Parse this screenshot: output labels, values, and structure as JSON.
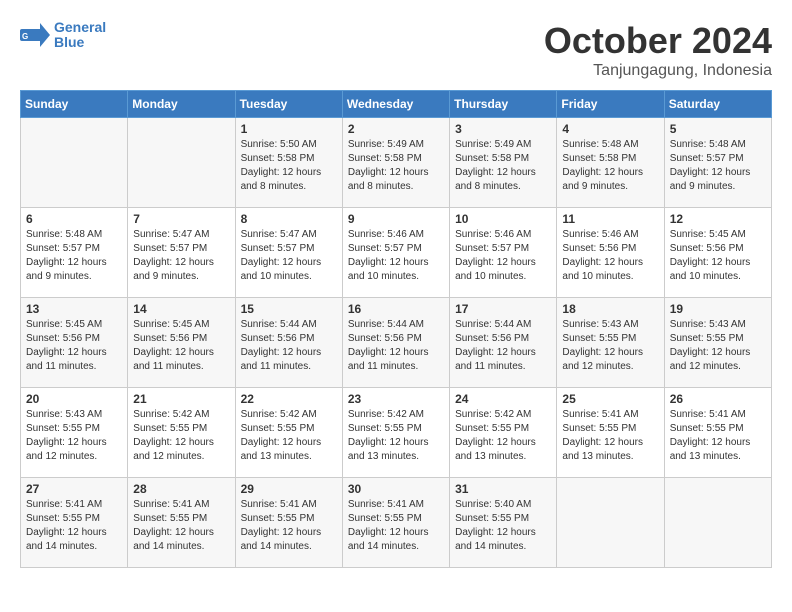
{
  "header": {
    "logo_line1": "General",
    "logo_line2": "Blue",
    "month": "October 2024",
    "location": "Tanjungagung, Indonesia"
  },
  "weekdays": [
    "Sunday",
    "Monday",
    "Tuesday",
    "Wednesday",
    "Thursday",
    "Friday",
    "Saturday"
  ],
  "weeks": [
    [
      {
        "day": "",
        "text": ""
      },
      {
        "day": "",
        "text": ""
      },
      {
        "day": "1",
        "text": "Sunrise: 5:50 AM\nSunset: 5:58 PM\nDaylight: 12 hours\nand 8 minutes."
      },
      {
        "day": "2",
        "text": "Sunrise: 5:49 AM\nSunset: 5:58 PM\nDaylight: 12 hours\nand 8 minutes."
      },
      {
        "day": "3",
        "text": "Sunrise: 5:49 AM\nSunset: 5:58 PM\nDaylight: 12 hours\nand 8 minutes."
      },
      {
        "day": "4",
        "text": "Sunrise: 5:48 AM\nSunset: 5:58 PM\nDaylight: 12 hours\nand 9 minutes."
      },
      {
        "day": "5",
        "text": "Sunrise: 5:48 AM\nSunset: 5:57 PM\nDaylight: 12 hours\nand 9 minutes."
      }
    ],
    [
      {
        "day": "6",
        "text": "Sunrise: 5:48 AM\nSunset: 5:57 PM\nDaylight: 12 hours\nand 9 minutes."
      },
      {
        "day": "7",
        "text": "Sunrise: 5:47 AM\nSunset: 5:57 PM\nDaylight: 12 hours\nand 9 minutes."
      },
      {
        "day": "8",
        "text": "Sunrise: 5:47 AM\nSunset: 5:57 PM\nDaylight: 12 hours\nand 10 minutes."
      },
      {
        "day": "9",
        "text": "Sunrise: 5:46 AM\nSunset: 5:57 PM\nDaylight: 12 hours\nand 10 minutes."
      },
      {
        "day": "10",
        "text": "Sunrise: 5:46 AM\nSunset: 5:57 PM\nDaylight: 12 hours\nand 10 minutes."
      },
      {
        "day": "11",
        "text": "Sunrise: 5:46 AM\nSunset: 5:56 PM\nDaylight: 12 hours\nand 10 minutes."
      },
      {
        "day": "12",
        "text": "Sunrise: 5:45 AM\nSunset: 5:56 PM\nDaylight: 12 hours\nand 10 minutes."
      }
    ],
    [
      {
        "day": "13",
        "text": "Sunrise: 5:45 AM\nSunset: 5:56 PM\nDaylight: 12 hours\nand 11 minutes."
      },
      {
        "day": "14",
        "text": "Sunrise: 5:45 AM\nSunset: 5:56 PM\nDaylight: 12 hours\nand 11 minutes."
      },
      {
        "day": "15",
        "text": "Sunrise: 5:44 AM\nSunset: 5:56 PM\nDaylight: 12 hours\nand 11 minutes."
      },
      {
        "day": "16",
        "text": "Sunrise: 5:44 AM\nSunset: 5:56 PM\nDaylight: 12 hours\nand 11 minutes."
      },
      {
        "day": "17",
        "text": "Sunrise: 5:44 AM\nSunset: 5:56 PM\nDaylight: 12 hours\nand 11 minutes."
      },
      {
        "day": "18",
        "text": "Sunrise: 5:43 AM\nSunset: 5:55 PM\nDaylight: 12 hours\nand 12 minutes."
      },
      {
        "day": "19",
        "text": "Sunrise: 5:43 AM\nSunset: 5:55 PM\nDaylight: 12 hours\nand 12 minutes."
      }
    ],
    [
      {
        "day": "20",
        "text": "Sunrise: 5:43 AM\nSunset: 5:55 PM\nDaylight: 12 hours\nand 12 minutes."
      },
      {
        "day": "21",
        "text": "Sunrise: 5:42 AM\nSunset: 5:55 PM\nDaylight: 12 hours\nand 12 minutes."
      },
      {
        "day": "22",
        "text": "Sunrise: 5:42 AM\nSunset: 5:55 PM\nDaylight: 12 hours\nand 13 minutes."
      },
      {
        "day": "23",
        "text": "Sunrise: 5:42 AM\nSunset: 5:55 PM\nDaylight: 12 hours\nand 13 minutes."
      },
      {
        "day": "24",
        "text": "Sunrise: 5:42 AM\nSunset: 5:55 PM\nDaylight: 12 hours\nand 13 minutes."
      },
      {
        "day": "25",
        "text": "Sunrise: 5:41 AM\nSunset: 5:55 PM\nDaylight: 12 hours\nand 13 minutes."
      },
      {
        "day": "26",
        "text": "Sunrise: 5:41 AM\nSunset: 5:55 PM\nDaylight: 12 hours\nand 13 minutes."
      }
    ],
    [
      {
        "day": "27",
        "text": "Sunrise: 5:41 AM\nSunset: 5:55 PM\nDaylight: 12 hours\nand 14 minutes."
      },
      {
        "day": "28",
        "text": "Sunrise: 5:41 AM\nSunset: 5:55 PM\nDaylight: 12 hours\nand 14 minutes."
      },
      {
        "day": "29",
        "text": "Sunrise: 5:41 AM\nSunset: 5:55 PM\nDaylight: 12 hours\nand 14 minutes."
      },
      {
        "day": "30",
        "text": "Sunrise: 5:41 AM\nSunset: 5:55 PM\nDaylight: 12 hours\nand 14 minutes."
      },
      {
        "day": "31",
        "text": "Sunrise: 5:40 AM\nSunset: 5:55 PM\nDaylight: 12 hours\nand 14 minutes."
      },
      {
        "day": "",
        "text": ""
      },
      {
        "day": "",
        "text": ""
      }
    ]
  ]
}
